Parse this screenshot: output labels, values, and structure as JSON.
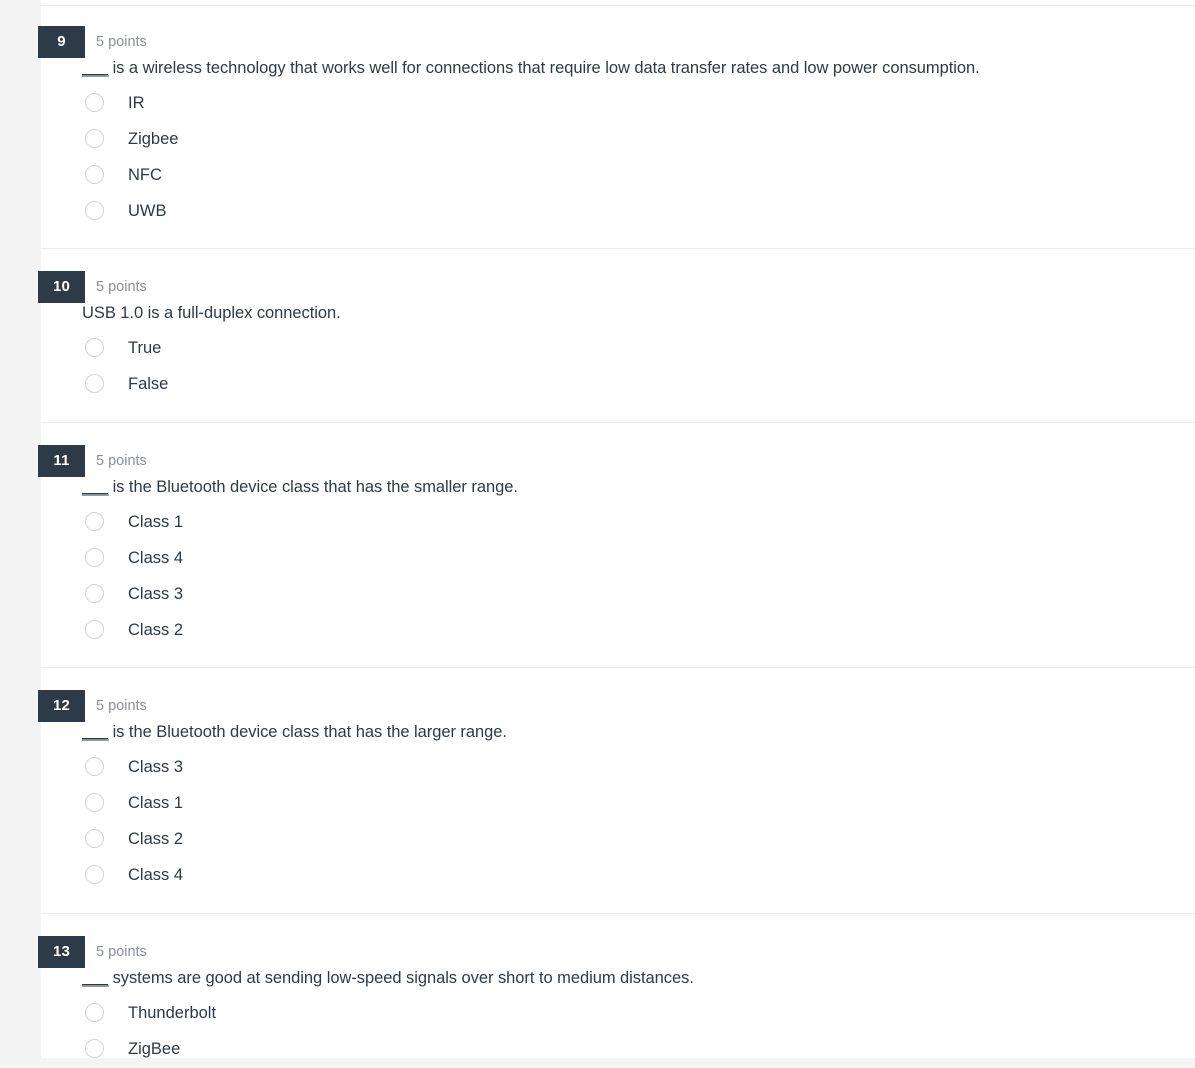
{
  "page": {
    "background_color": "#f4f4f4",
    "content_background": "#ffffff",
    "badge_color": "#2c3b47",
    "points_text_color": "#8b9096",
    "question_text_color": "#2f3a43",
    "divider_color": "#ececec",
    "radio_border_color": "#d2d3d5"
  },
  "questions": [
    {
      "number": "9",
      "points": "5 points",
      "blank": "___",
      "text": " is a wireless technology that works well for connections that require low data transfer rates and low power consumption.",
      "options": [
        {
          "label": "IR",
          "selected": false
        },
        {
          "label": "Zigbee",
          "selected": false
        },
        {
          "label": "NFC",
          "selected": false
        },
        {
          "label": "UWB",
          "selected": false
        }
      ]
    },
    {
      "number": "10",
      "points": "5 points",
      "blank": "",
      "text": "USB 1.0 is a full-duplex connection.",
      "options": [
        {
          "label": "True",
          "selected": false
        },
        {
          "label": "False",
          "selected": false
        }
      ]
    },
    {
      "number": "11",
      "points": "5 points",
      "blank": "___",
      "text": " is the Bluetooth device class that has the smaller range.",
      "options": [
        {
          "label": "Class 1",
          "selected": false
        },
        {
          "label": "Class 4",
          "selected": false
        },
        {
          "label": "Class 3",
          "selected": false
        },
        {
          "label": "Class 2",
          "selected": false
        }
      ]
    },
    {
      "number": "12",
      "points": "5 points",
      "blank": "___",
      "text": " is the Bluetooth device class that has the larger range.",
      "options": [
        {
          "label": "Class 3",
          "selected": false
        },
        {
          "label": "Class 1",
          "selected": false
        },
        {
          "label": "Class 2",
          "selected": false
        },
        {
          "label": "Class 4",
          "selected": false
        }
      ]
    },
    {
      "number": "13",
      "points": "5 points",
      "blank": "___",
      "text": " systems are good at sending low-speed signals over short to medium distances.",
      "options": [
        {
          "label": "Thunderbolt",
          "selected": false
        },
        {
          "label": "ZigBee",
          "selected": false
        }
      ]
    }
  ],
  "layout": {
    "question_tops": [
      26,
      271,
      445,
      690,
      936
    ],
    "divider_tops": [
      5,
      248,
      422,
      667,
      913
    ]
  }
}
